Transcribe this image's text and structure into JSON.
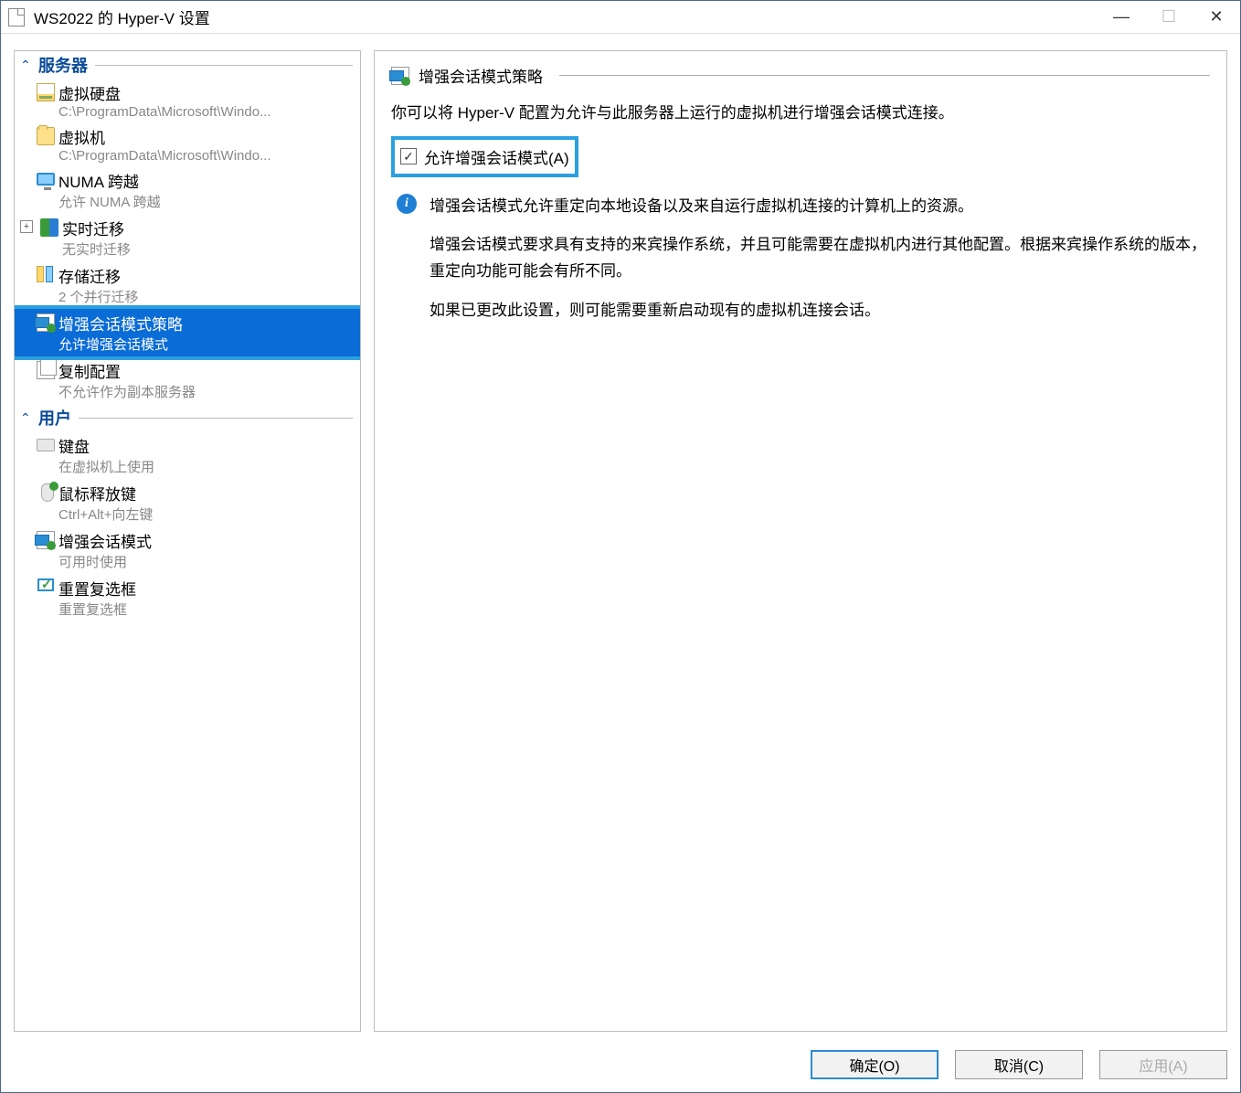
{
  "window": {
    "title": "WS2022 的 Hyper-V 设置"
  },
  "sidebar": {
    "sections": [
      {
        "header": "服务器",
        "items": [
          {
            "title": "虚拟硬盘",
            "subtitle": "C:\\ProgramData\\Microsoft\\Windo...",
            "icon": "disk"
          },
          {
            "title": "虚拟机",
            "subtitle": "C:\\ProgramData\\Microsoft\\Windo...",
            "icon": "folder"
          },
          {
            "title": "NUMA 跨越",
            "subtitle": "允许 NUMA 跨越",
            "icon": "monitor"
          },
          {
            "title": "实时迁移",
            "subtitle": "无实时迁移",
            "icon": "chips",
            "expandable": true
          },
          {
            "title": "存储迁移",
            "subtitle": "2 个并行迁移",
            "icon": "bars"
          },
          {
            "title": "增强会话模式策略",
            "subtitle": "允许增强会话模式",
            "icon": "policy",
            "selected": true,
            "highlight": true
          },
          {
            "title": "复制配置",
            "subtitle": "不允许作为副本服务器",
            "icon": "copy"
          }
        ]
      },
      {
        "header": "用户",
        "items": [
          {
            "title": "键盘",
            "subtitle": "在虚拟机上使用",
            "icon": "kbd"
          },
          {
            "title": "鼠标释放键",
            "subtitle": "Ctrl+Alt+向左键",
            "icon": "mouse"
          },
          {
            "title": "增强会话模式",
            "subtitle": "可用时使用",
            "icon": "policy"
          },
          {
            "title": "重置复选框",
            "subtitle": "重置复选框",
            "icon": "check"
          }
        ]
      }
    ]
  },
  "main": {
    "heading": "增强会话模式策略",
    "description": "你可以将 Hyper-V 配置为允许与此服务器上运行的虚拟机进行增强会话模式连接。",
    "checkbox_label": "允许增强会话模式(A)",
    "checkbox_checked": true,
    "info_paragraphs": [
      "增强会话模式允许重定向本地设备以及来自运行虚拟机连接的计算机上的资源。",
      "增强会话模式要求具有支持的来宾操作系统，并且可能需要在虚拟机内进行其他配置。根据来宾操作系统的版本，重定向功能可能会有所不同。",
      "如果已更改此设置，则可能需要重新启动现有的虚拟机连接会话。"
    ]
  },
  "buttons": {
    "ok": "确定(O)",
    "cancel": "取消(C)",
    "apply": "应用(A)"
  }
}
